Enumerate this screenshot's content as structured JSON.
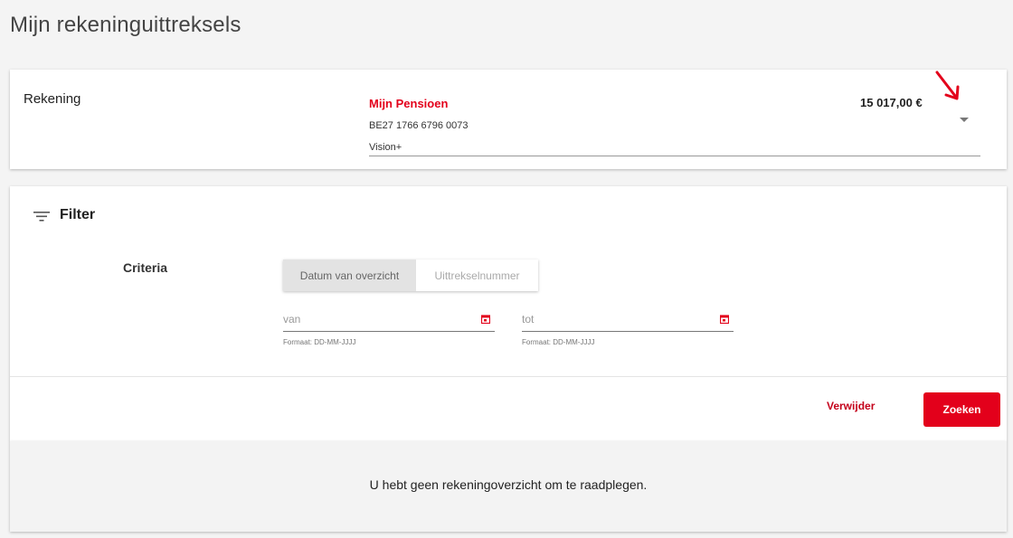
{
  "page": {
    "title": "Mijn rekeninguittreksels"
  },
  "account": {
    "label": "Rekening",
    "name": "Mijn Pensioen",
    "iban": "BE27 1766 6796 0073",
    "type": "Vision+",
    "balance": "15 017,00 €",
    "chevron_icon": "chevron-down-icon"
  },
  "filter": {
    "title": "Filter",
    "icon": "filter-icon",
    "criteria_label": "Criteria",
    "tabs": [
      {
        "label": "Datum van overzicht",
        "active": true
      },
      {
        "label": "Uittrekselnummer",
        "active": false
      }
    ],
    "from_placeholder": "van",
    "to_placeholder": "tot",
    "format_hint": "Formaat: DD-MM-JJJJ",
    "calendar_icon": "calendar-icon",
    "remove_label": "Verwijder",
    "search_label": "Zoeken"
  },
  "result": {
    "message": "U hebt geen rekeningoverzicht om te raadplegen."
  },
  "colors": {
    "accent": "#e3001b",
    "accent_dark": "#c4001a"
  }
}
